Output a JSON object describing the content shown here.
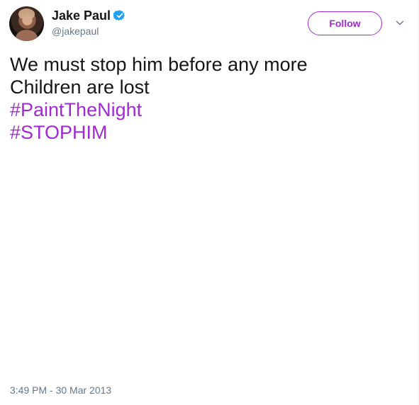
{
  "tweet": {
    "author": {
      "display_name": "Jake Paul",
      "handle": "@jakepaul",
      "verified": true,
      "avatar_icon": "profile-photo"
    },
    "follow_label": "Follow",
    "menu_icon": "chevron-down-icon",
    "text_lines": [
      "We must stop him before any more",
      "Children are lost"
    ],
    "hashtags": [
      "#PaintTheNight",
      "#STOPHIM"
    ],
    "timestamp": "3:49 PM - 30 Mar 2013"
  },
  "colors": {
    "accent": "#a22ad5",
    "text": "#14171a",
    "secondary": "#657786",
    "verified": "#1da1f2"
  }
}
